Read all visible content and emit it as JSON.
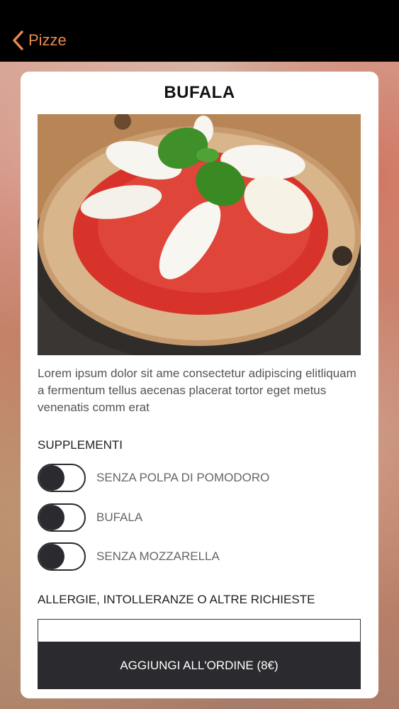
{
  "nav": {
    "back_label": "Pizze",
    "back_icon": "chevron-left-icon",
    "accent_color": "#e88a4e"
  },
  "product": {
    "title": "BUFALA",
    "description": "Lorem ipsum dolor sit ame consectetur adipiscing elitliquam a fermentum tellus aecenas placerat tortor eget metus venenatis comm erat"
  },
  "supplements": {
    "label": "SUPPLEMENTI",
    "options": [
      {
        "label": "SENZA POLPA DI POMODORO",
        "enabled": false
      },
      {
        "label": "BUFALA",
        "enabled": false
      },
      {
        "label": "SENZA MOZZARELLA",
        "enabled": false
      }
    ]
  },
  "notes": {
    "label": "ALLERGIE, INTOLLERANZE O ALTRE RICHIESTE",
    "value": ""
  },
  "cta": {
    "label": "AGGIUNGI ALL'ORDINE (8€)",
    "color": "#2b2b2f"
  }
}
